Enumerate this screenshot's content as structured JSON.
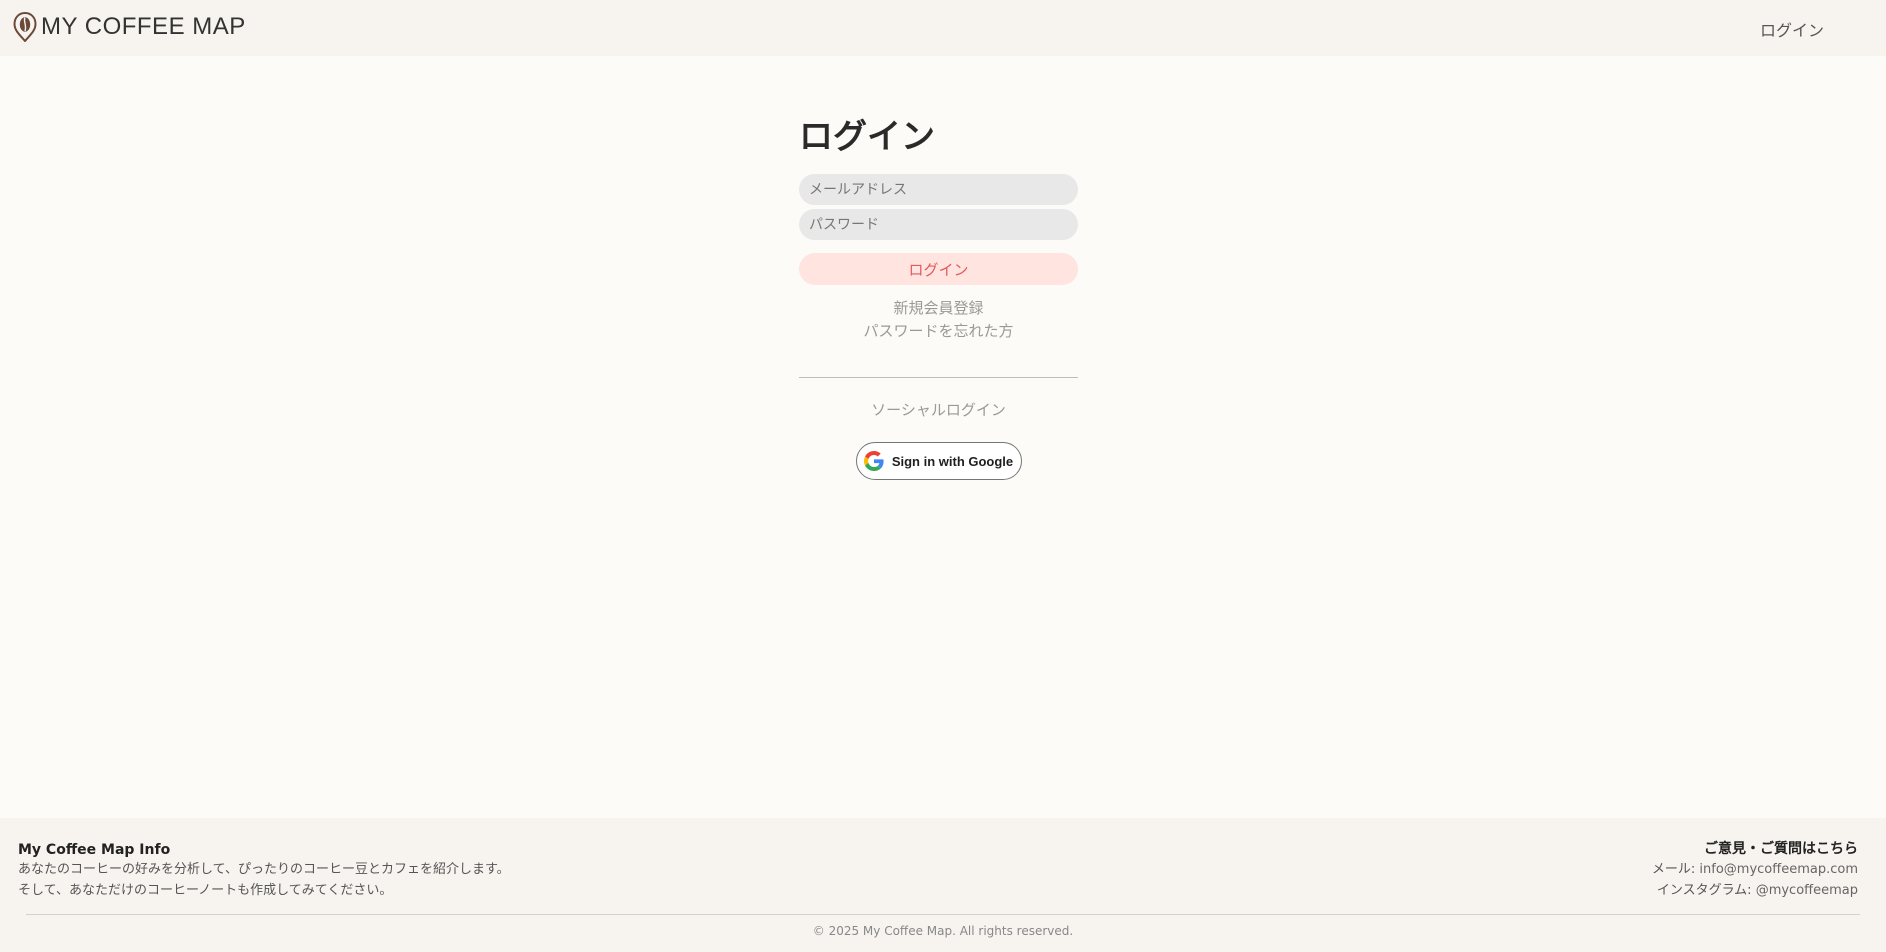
{
  "header": {
    "logo_text": "MY COFFEE MAP",
    "login_link": "ログイン"
  },
  "login": {
    "title": "ログイン",
    "email_placeholder": "メールアドレス",
    "password_placeholder": "パスワード",
    "login_button": "ログイン",
    "register_link": "新規会員登録",
    "forgot_password_link": "パスワードを忘れた方",
    "social_label": "ソーシャルログイン",
    "google_button": "Sign in with Google"
  },
  "footer": {
    "info_title": "My Coffee Map Info",
    "info_line1": "あなたのコーヒーの好みを分析して、ぴったりのコーヒー豆とカフェを紹介します。",
    "info_line2": "そして、あなただけのコーヒーノートも作成してみてください。",
    "contact_title": "ご意見・ご質問はこちら",
    "email_label": "メール: ",
    "email_value": "info@mycoffeemap.com",
    "instagram_label": "インスタグラム: ",
    "instagram_value": "@mycoffeemap",
    "copyright": "© 2025 My Coffee Map. All rights reserved."
  },
  "colors": {
    "background": "#fdfbf7",
    "header_footer_bg": "#f7f4f0",
    "login_button_bg": "#ffe4e0",
    "login_button_text": "#e5585c",
    "logo_brown": "#6b4a3a"
  },
  "icons": [
    "coffee-bean-pin-icon",
    "google-g-icon"
  ]
}
